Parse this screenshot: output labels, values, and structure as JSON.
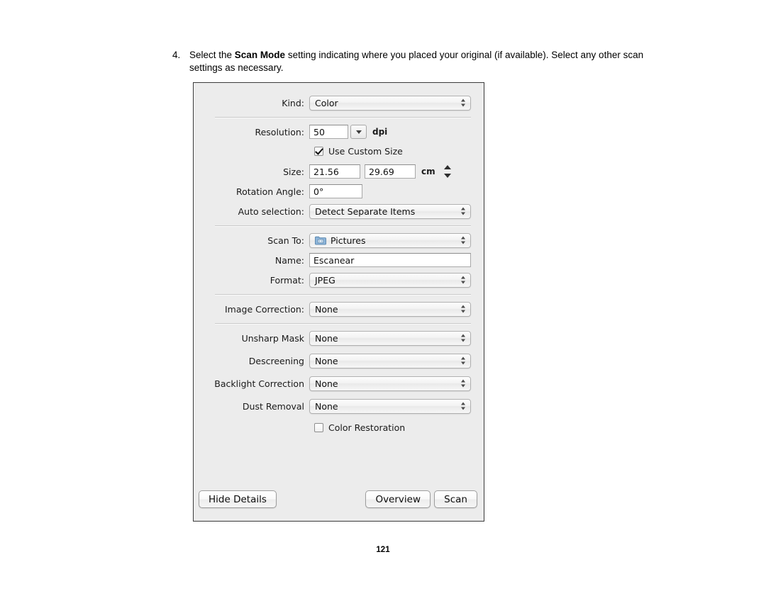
{
  "document": {
    "step_number": "4.",
    "step_text_before": "Select the ",
    "step_text_bold": "Scan Mode",
    "step_text_after": " setting indicating where you placed your original (if available). Select any other scan settings as necessary.",
    "page_number": "121"
  },
  "dialog": {
    "kind": {
      "label": "Kind:",
      "value": "Color"
    },
    "resolution": {
      "label": "Resolution:",
      "value": "50",
      "unit": "dpi"
    },
    "use_custom_size": {
      "label": "Use Custom Size",
      "checked": true
    },
    "size": {
      "label": "Size:",
      "width_value": "21.56",
      "height_value": "29.69",
      "unit": "cm"
    },
    "rotation_angle": {
      "label": "Rotation Angle:",
      "value": "0°"
    },
    "auto_selection": {
      "label": "Auto selection:",
      "value": "Detect Separate Items"
    },
    "scan_to": {
      "label": "Scan To:",
      "value": "Pictures",
      "icon": "pictures-folder-icon"
    },
    "name": {
      "label": "Name:",
      "value": "Escanear"
    },
    "format": {
      "label": "Format:",
      "value": "JPEG"
    },
    "image_correction": {
      "label": "Image Correction:",
      "value": "None"
    },
    "unsharp_mask": {
      "label": "Unsharp Mask",
      "value": "None"
    },
    "descreening": {
      "label": "Descreening",
      "value": "None"
    },
    "backlight_correction": {
      "label": "Backlight Correction",
      "value": "None"
    },
    "dust_removal": {
      "label": "Dust Removal",
      "value": "None"
    },
    "color_restoration": {
      "label": "Color Restoration",
      "checked": false
    },
    "buttons": {
      "hide_details": "Hide Details",
      "overview": "Overview",
      "scan": "Scan"
    },
    "colors": {
      "background": "#ececec",
      "border": "#3a3a3a",
      "folder_icon": "#7ba7cc"
    }
  }
}
